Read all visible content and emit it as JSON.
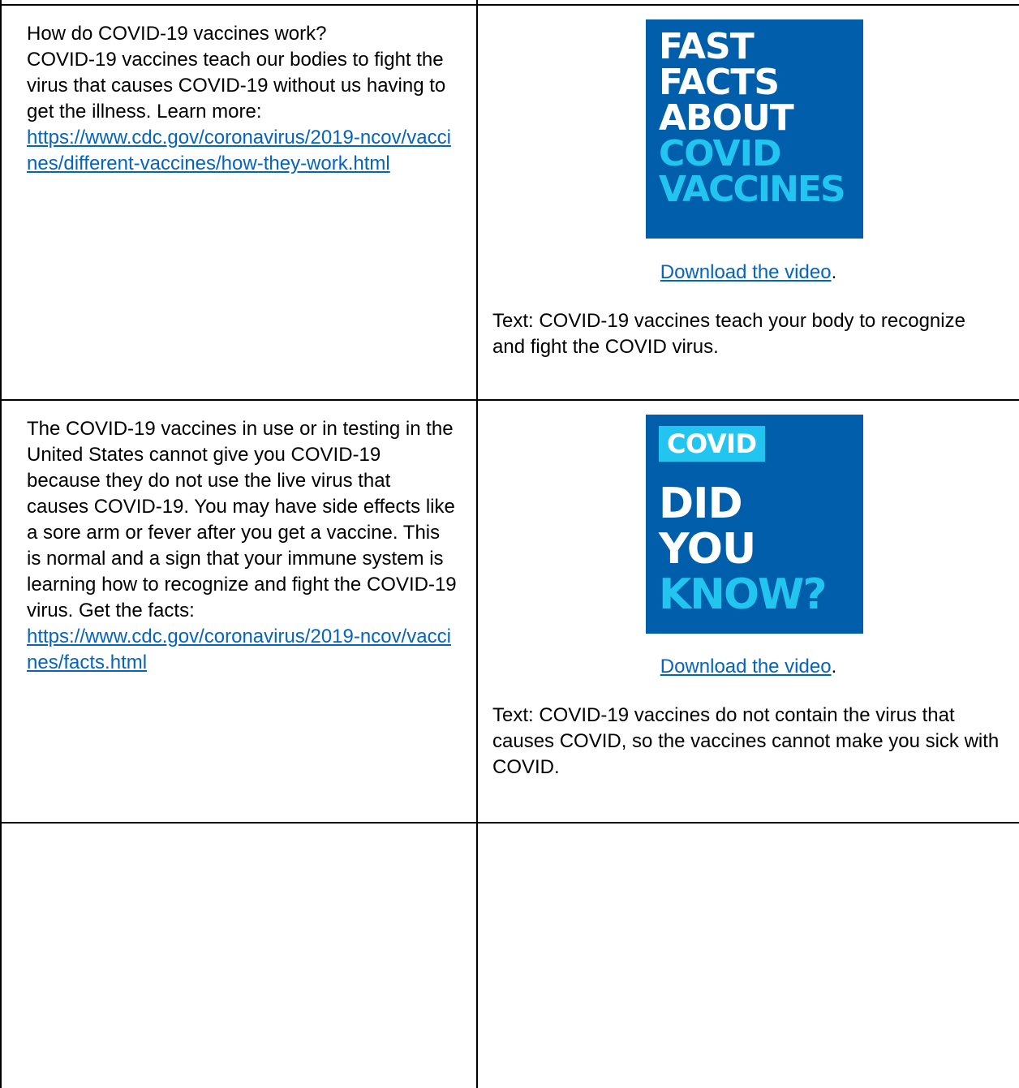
{
  "colors": {
    "link": "#0563c1",
    "tile_bg": "#005eaa",
    "tile_accent": "#22c5f0",
    "tile_text": "#ffffff"
  },
  "row1": {
    "left": {
      "line1": "How do COVID-19 vaccines work?",
      "body": "COVID-19 vaccines teach our bodies to fight the virus that causes COVID-19 without us having to get the illness. Learn more:",
      "link": "https://www.cdc.gov/coronavirus/2019-ncov/vaccines/different-vaccines/how-they-work.html"
    },
    "right": {
      "tile": {
        "line1": "FAST",
        "line2": "FACTS",
        "line3": "ABOUT",
        "line4": "COVID",
        "line5": "VACCINES"
      },
      "download_link": "Download the video",
      "download_period": ".",
      "text": "Text: COVID-19 vaccines teach your body to recognize and fight the COVID virus."
    }
  },
  "row2": {
    "left": {
      "body": "The COVID-19 vaccines in use or in testing in the United States cannot give you COVID-19 because they do not use the live virus that causes COVID-19. You may have side effects like a sore arm or fever after you get a vaccine. This is normal and a sign that your immune system is learning how to recognize and fight the COVID-19 virus. Get the facts:",
      "link": "https://www.cdc.gov/coronavirus/2019-ncov/vaccines/facts.html"
    },
    "right": {
      "tile": {
        "badge": "COVID",
        "line1": "DID",
        "line2": "YOU",
        "line3": "KNOW?"
      },
      "download_link": "Download the video",
      "download_period": ".",
      "text": "Text: COVID-19 vaccines do not contain the virus that causes COVID, so the vaccines cannot make you sick with COVID."
    }
  }
}
